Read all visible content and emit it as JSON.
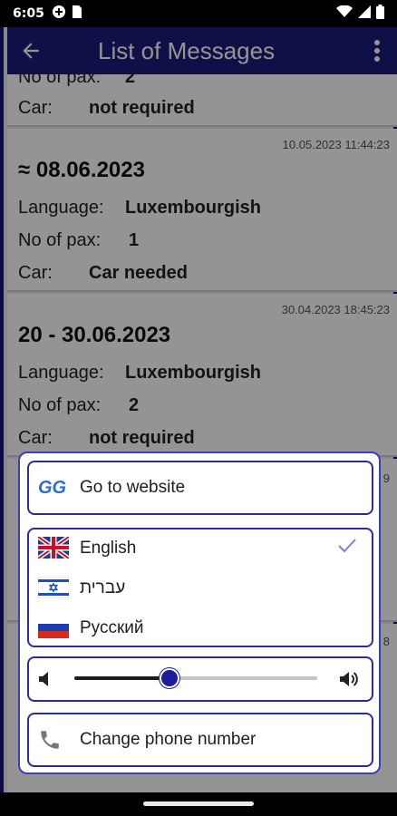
{
  "status_bar": {
    "time": "6:05"
  },
  "app_bar": {
    "title": "List of Messages"
  },
  "messages": [
    {
      "pax_label": "No of pax:",
      "pax": "2",
      "car_label": "Car:",
      "car": "not required"
    },
    {
      "timestamp": "10.05.2023   11:44:23",
      "date": "≈ 08.06.2023",
      "language_label": "Language:",
      "language": "Luxembourgish",
      "pax_label": "No of pax:",
      "pax": "1",
      "car_label": "Car:",
      "car": "Car needed"
    },
    {
      "timestamp": "30.04.2023   18:45:23",
      "date": "20 - 30.06.2023",
      "language_label": "Language:",
      "language": "Luxembourgish",
      "pax_label": "No of pax:",
      "pax": "2",
      "car_label": "Car:",
      "car": "not required"
    }
  ],
  "hidden_stamp_tail_1": "9",
  "hidden_stamp_tail_2": "8",
  "menu": {
    "website": {
      "logo_text": "GG",
      "label": "Go to website"
    },
    "languages": [
      {
        "label": "English",
        "flag": "uk-flag",
        "selected": true
      },
      {
        "label": "עברית",
        "flag": "israel-flag",
        "selected": false
      },
      {
        "label": "Русский",
        "flag": "russia-flag",
        "selected": false
      }
    ],
    "volume": {
      "level_fraction": 0.39
    },
    "phone": {
      "label": "Change phone number"
    }
  },
  "colors": {
    "app_bar": "#1d1d7c",
    "accent": "#2b2b9c",
    "check": "#8080d0"
  }
}
